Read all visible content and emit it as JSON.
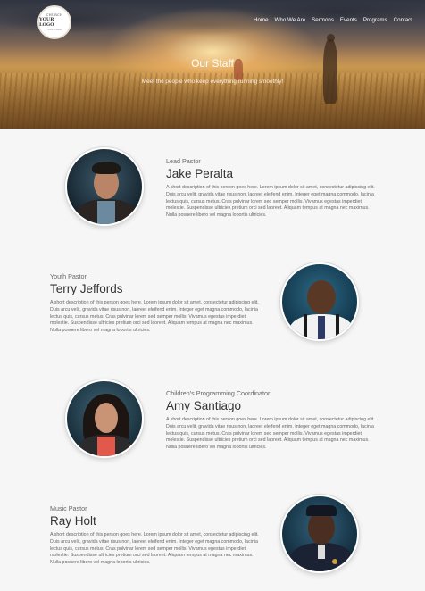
{
  "header": {
    "logo": {
      "line1": "CHURCH",
      "line2": "YOUR LOGO",
      "line3": "EST. 1908"
    },
    "nav": [
      "Home",
      "Who We Are",
      "Sermons",
      "Events",
      "Programs",
      "Contact"
    ],
    "title": "Our Staff",
    "subtitle": "Meet the people who keep everything running smoothly!"
  },
  "staff": [
    {
      "role": "Lead Pastor",
      "name": "Jake Peralta",
      "description": "A short description of this person goes here. Lorem ipsum dolor sit amet, consectetur adipiscing elit. Duis arcu velit, gravida vitae risus non, laoreet eleifend enim. Integer eget magna commodo, lacinia lectus quis, cursus metus. Cras pulvinar lorem sed semper mollis. Vivamus egestas imperdiet molestie. Suspendisse ultricies pretium orci sed laoreet. Aliquam tempus at magna nec maximus. Nulla posuere libero vel magna lobortis ultricies."
    },
    {
      "role": "Youth Pastor",
      "name": "Terry Jeffords",
      "description": "A short description of this person goes here. Lorem ipsum dolor sit amet, consectetur adipiscing elit. Duis arcu velit, gravida vitae risus non, laoreet eleifend enim. Integer eget magna commodo, lacinia lectus quis, cursus metus. Cras pulvinar lorem sed semper mollis. Vivamus egestas imperdiet molestie. Suspendisse ultricies pretium orci sed laoreet. Aliquam tempus at magna nec maximus. Nulla posuere libero vel magna lobortis ultricies."
    },
    {
      "role": "Children's Programming Coordinator",
      "name": "Amy Santiago",
      "description": "A short description of this person goes here. Lorem ipsum dolor sit amet, consectetur adipiscing elit. Duis arcu velit, gravida vitae risus non, laoreet eleifend enim. Integer eget magna commodo, lacinia lectus quis, cursus metus. Cras pulvinar lorem sed semper mollis. Vivamus egestas imperdiet molestie. Suspendisse ultricies pretium orci sed laoreet. Aliquam tempus at magna nec maximus. Nulla posuere libero vel magna lobortis ultricies."
    },
    {
      "role": "Music Pastor",
      "name": "Ray Holt",
      "description": "A short description of this person goes here. Lorem ipsum dolor sit amet, consectetur adipiscing elit. Duis arcu velit, gravida vitae risus non, laoreet eleifend enim. Integer eget magna commodo, lacinia lectus quis, cursus metus. Cras pulvinar lorem sed semper mollis. Vivamus egestas imperdiet molestie. Suspendisse ultricies pretium orci sed laoreet. Aliquam tempus at magna nec maximus. Nulla posuere libero vel magna lobortis ultricies."
    }
  ]
}
